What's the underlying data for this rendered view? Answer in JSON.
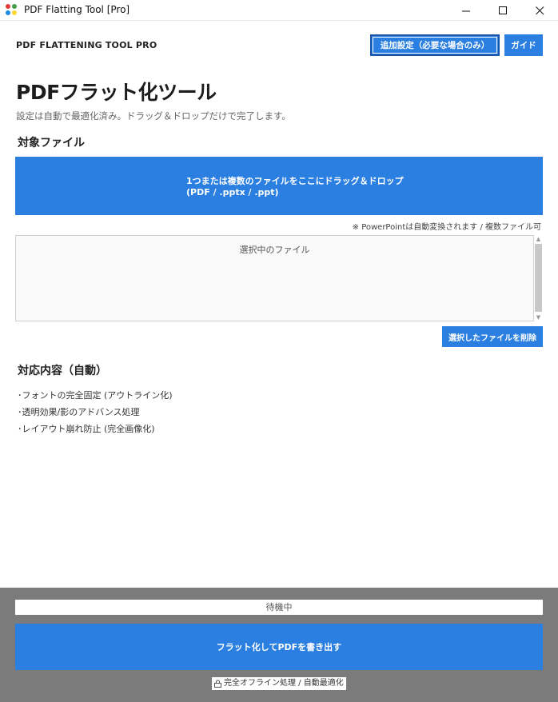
{
  "window": {
    "title": "PDF Flatting Tool [Pro]",
    "controls": {
      "minimize": "—",
      "maximize": "☐",
      "close": "✕"
    },
    "icon": "app-logo-icon"
  },
  "header": {
    "app_name": "PDF FLATTENING TOOL PRO",
    "settings_button": "追加設定（必要な場合のみ）",
    "guide_button": "ガイド"
  },
  "main": {
    "title": "PDFフラット化ツール",
    "subtitle": "設定は自動で最適化済み。ドラッグ＆ドロップだけで完了します。",
    "target_label": "対象ファイル",
    "dropzone": {
      "line1": "1つまたは複数のファイルをここにドラッグ＆ドロップ",
      "line2": "(PDF / .pptx / .ppt)"
    },
    "drop_note": "※ PowerPointは自動変換されます / 複数ファイル可",
    "file_list_header": "選択中のファイル",
    "delete_button": "選択したファイルを削除",
    "features_label": "対応内容（自動）",
    "features": [
      "･フォントの完全固定 (アウトライン化)",
      "･透明効果/影のアドバンス処理",
      "･レイアウト崩れ防止 (完全画像化)"
    ]
  },
  "footer": {
    "status": "待機中",
    "export_button": "フラット化してPDFを書き出す",
    "note": "完全オフライン処理 / 自動最適化",
    "note_icon": "lock-icon"
  },
  "colors": {
    "accent": "#2a7fe0",
    "footer_bg": "#7b7b7b"
  }
}
